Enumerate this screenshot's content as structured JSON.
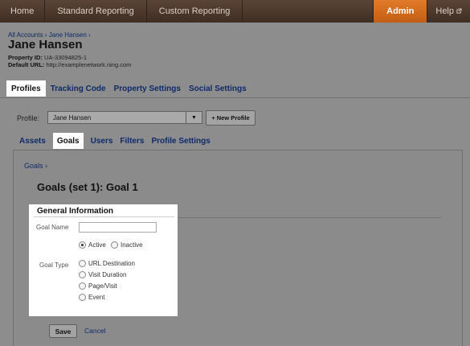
{
  "nav": {
    "home": "Home",
    "standard_reporting": "Standard Reporting",
    "custom_reporting": "Custom Reporting",
    "admin": "Admin",
    "help": "Help",
    "help_icon": "external-link-icon"
  },
  "account": {
    "breadcrumb": "All Accounts › Jane Hansen ›",
    "title": "Jane Hansen",
    "property_id_label": "Property ID:",
    "property_id": "UA-33094825-1",
    "default_url_label": "Default URL:",
    "default_url": "http://examplenetwork.ning.com"
  },
  "main_tabs": [
    {
      "label": "Profiles",
      "active": true
    },
    {
      "label": "Tracking Code",
      "active": false
    },
    {
      "label": "Property Settings",
      "active": false
    },
    {
      "label": "Social Settings",
      "active": false
    }
  ],
  "profile": {
    "label": "Profile:",
    "selected": "Jane Hansen",
    "new_profile": "+ New Profile"
  },
  "sub_tabs": [
    {
      "label": "Assets",
      "active": false
    },
    {
      "label": "Goals",
      "active": true
    },
    {
      "label": "Users",
      "active": false
    },
    {
      "label": "Filters",
      "active": false
    },
    {
      "label": "Profile Settings",
      "active": false
    }
  ],
  "goal": {
    "crumb": "Goals ›",
    "heading": "Goals (set 1): Goal 1",
    "section_title": "General Information",
    "goal_name_label": "Goal Name",
    "goal_name_value": "",
    "status_options": [
      {
        "label": "Active",
        "checked": true
      },
      {
        "label": "Inactive",
        "checked": false
      }
    ],
    "goal_type_label": "Goal Type",
    "goal_type_options": [
      {
        "label": "URL Destination",
        "checked": false
      },
      {
        "label": "Visit Duration",
        "checked": false
      },
      {
        "label": "Page/Visit",
        "checked": false
      },
      {
        "label": "Event",
        "checked": false
      }
    ],
    "save": "Save",
    "cancel": "Cancel"
  }
}
